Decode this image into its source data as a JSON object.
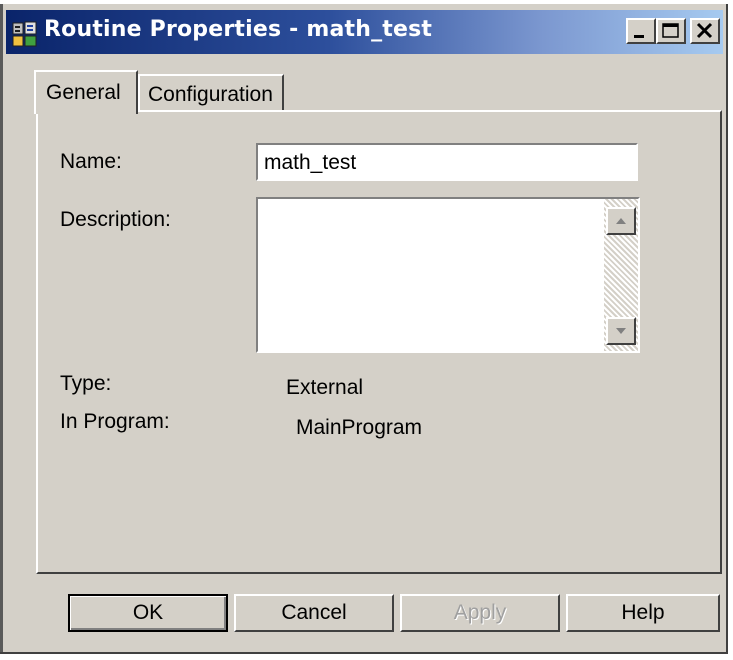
{
  "window": {
    "title": "Routine Properties - math_test",
    "controls": {
      "minimize": "minimize-icon",
      "maximize": "maximize-icon",
      "close": "close-icon"
    }
  },
  "tabs": [
    {
      "label": "General",
      "active": true
    },
    {
      "label": "Configuration",
      "active": false
    }
  ],
  "general": {
    "name_label": "Name:",
    "name_value": "math_test",
    "description_label": "Description:",
    "description_value": "",
    "type_label": "Type:",
    "type_value": "External",
    "type_icon": "external-routine-icon",
    "program_label": "In Program:",
    "program_value": "MainProgram",
    "program_icon": "program-folder-icon"
  },
  "buttons": {
    "ok": "OK",
    "cancel": "Cancel",
    "apply": "Apply",
    "help": "Help"
  },
  "colors": {
    "titlebar_start": "#0a246a",
    "titlebar_end": "#a6caf0",
    "face": "#d4d0c8",
    "disabled_text": "#a0a0a0"
  }
}
